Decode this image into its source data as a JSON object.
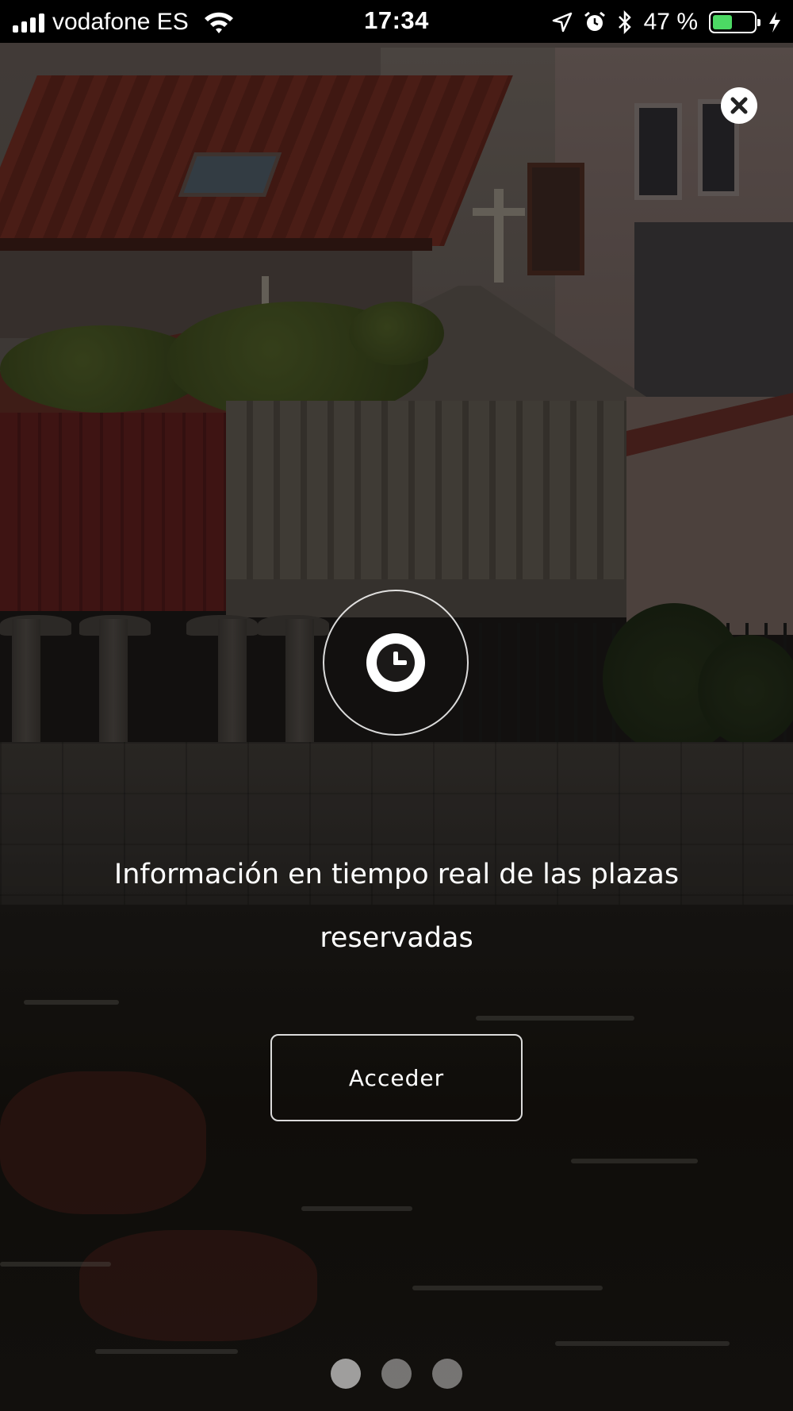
{
  "status_bar": {
    "carrier": "vodafone ES",
    "time": "17:34",
    "battery_percent": "47 %",
    "battery_level": 0.47,
    "icons": [
      "signal-icon",
      "wifi-icon",
      "location-arrow-icon",
      "alarm-icon",
      "bluetooth-icon",
      "battery-icon",
      "charging-bolt-icon"
    ]
  },
  "onboarding": {
    "close_icon": "close-icon",
    "feature_icon": "clock-icon",
    "feature_text": "Información en tiempo real de las plazas reservadas",
    "access_button_label": "Acceder",
    "page_count": 3,
    "current_page": 1
  },
  "colors": {
    "battery_fill": "#4cd964",
    "overlay": "#000000"
  }
}
